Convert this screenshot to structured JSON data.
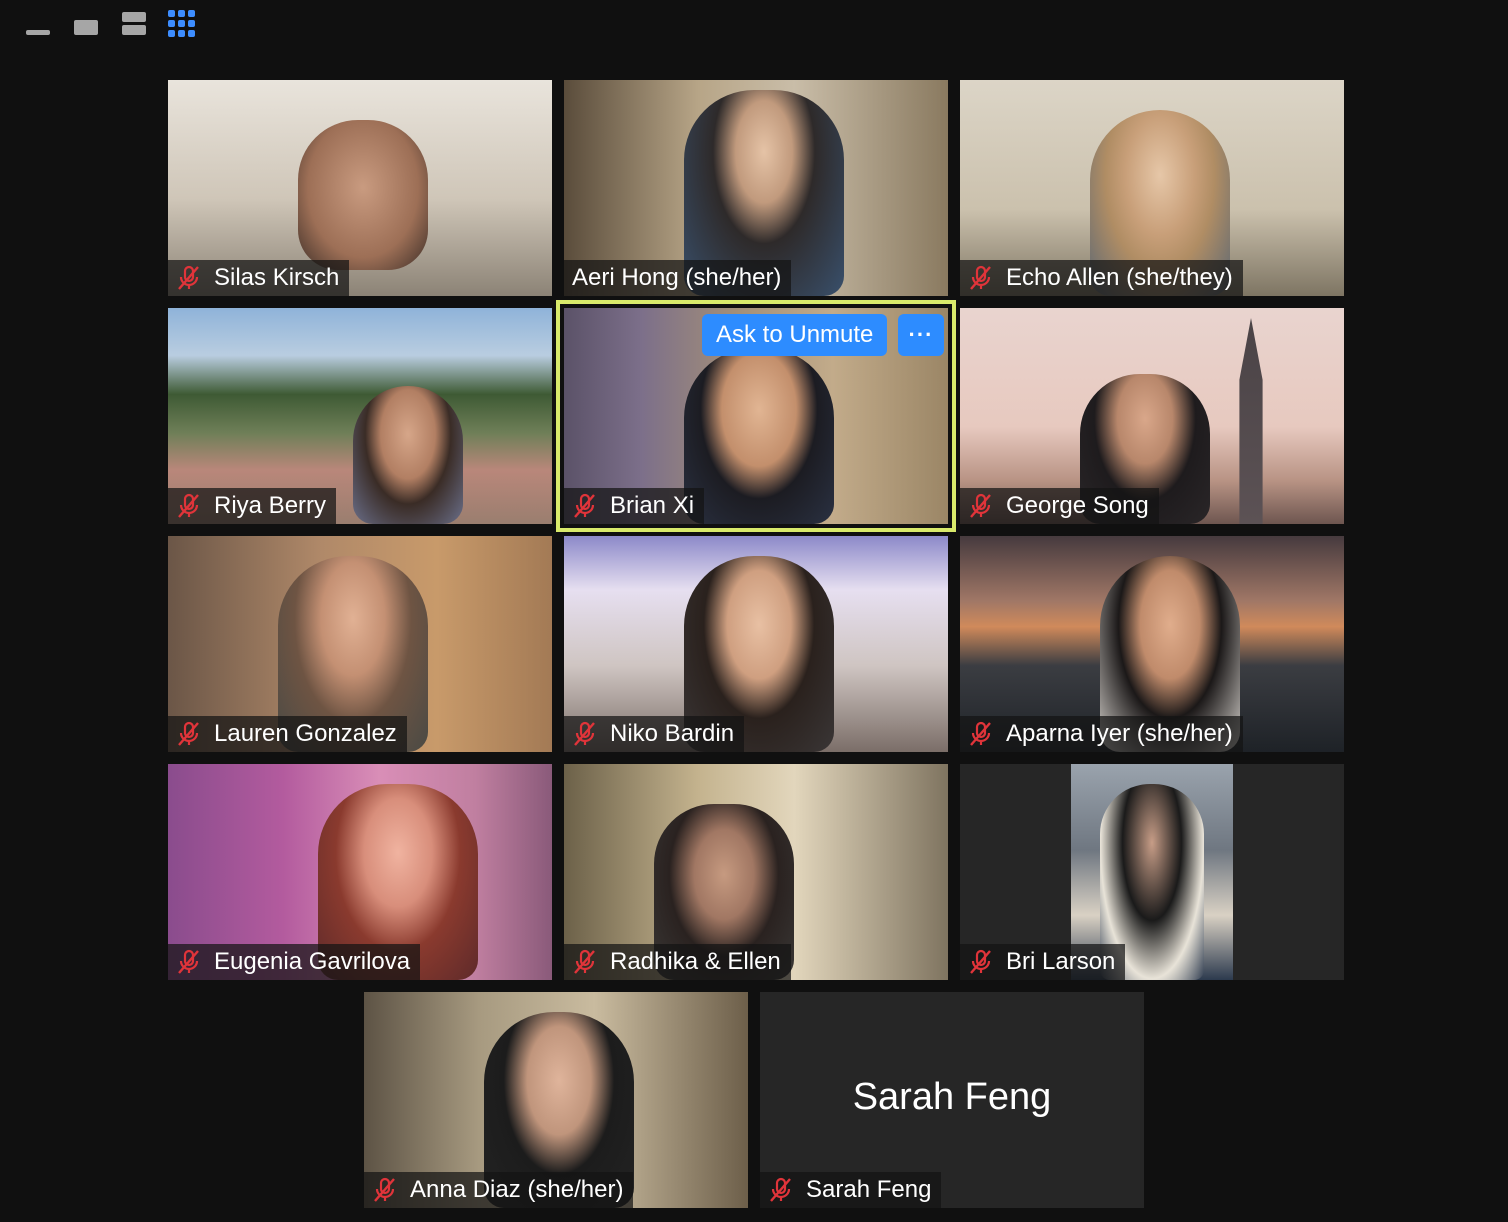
{
  "view_controls": [
    {
      "name": "minimize",
      "active": false
    },
    {
      "name": "single-speaker-view",
      "active": false
    },
    {
      "name": "split-view",
      "active": false
    },
    {
      "name": "gallery-view",
      "active": true
    }
  ],
  "colors": {
    "background": "#101010",
    "active_speaker_border": "#d9ea6b",
    "button_blue": "#2d8cff",
    "muted_icon": "#e0343a"
  },
  "participants": [
    {
      "name": "Silas Kirsch",
      "muted": true
    },
    {
      "name": "Aeri Hong (she/her)",
      "muted": false
    },
    {
      "name": "Echo Allen (she/they)",
      "muted": true
    },
    {
      "name": "Riya Berry",
      "muted": true
    },
    {
      "name": "Brian Xi",
      "muted": true,
      "active_speaker": true
    },
    {
      "name": "George Song",
      "muted": true
    },
    {
      "name": "Lauren Gonzalez",
      "muted": true
    },
    {
      "name": "Niko Bardin",
      "muted": true
    },
    {
      "name": "Aparna Iyer (she/her)",
      "muted": true
    },
    {
      "name": "Eugenia Gavrilova",
      "muted": true
    },
    {
      "name": "Radhika & Ellen",
      "muted": true
    },
    {
      "name": "Bri Larson",
      "muted": true
    },
    {
      "name": "Anna Diaz  (she/her)",
      "muted": true
    },
    {
      "name": "Sarah Feng",
      "muted": true,
      "video_off": true
    }
  ],
  "no_video_display_name": "Sarah Feng",
  "ask_to_unmute_label": "Ask to Unmute",
  "more_options_label": "···",
  "icons": {
    "muted": "microphone-muted-icon"
  }
}
